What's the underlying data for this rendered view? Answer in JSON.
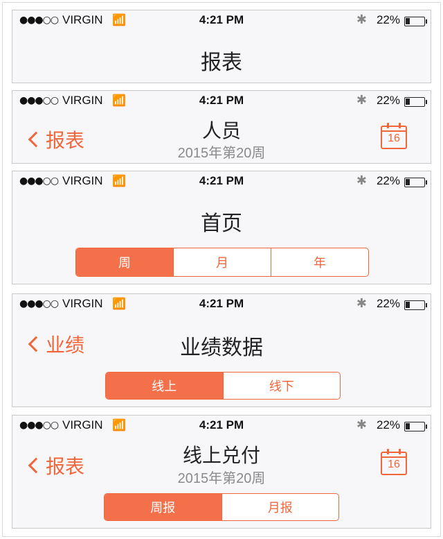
{
  "status": {
    "carrier": "VIRGIN",
    "time": "4:21 PM",
    "battery": "22%"
  },
  "panels": {
    "p1": {
      "title": "报表"
    },
    "p2": {
      "back": "报表",
      "title": "人员",
      "subtitle": "2015年第20周",
      "calendar_day": "16"
    },
    "p3": {
      "title": "首页",
      "segments": [
        "周",
        "月",
        "年"
      ],
      "selected": "周"
    },
    "p4": {
      "back": "业绩",
      "title": "业绩数据",
      "segments": [
        "线上",
        "线下"
      ],
      "selected": "线上"
    },
    "p5": {
      "back": "报表",
      "title": "线上兑付",
      "subtitle": "2015年第20周",
      "calendar_day": "16",
      "segments": [
        "周报",
        "月报"
      ],
      "selected": "周报"
    }
  },
  "colors": {
    "accent": "#f0663a",
    "background": "#f7f7f9"
  }
}
